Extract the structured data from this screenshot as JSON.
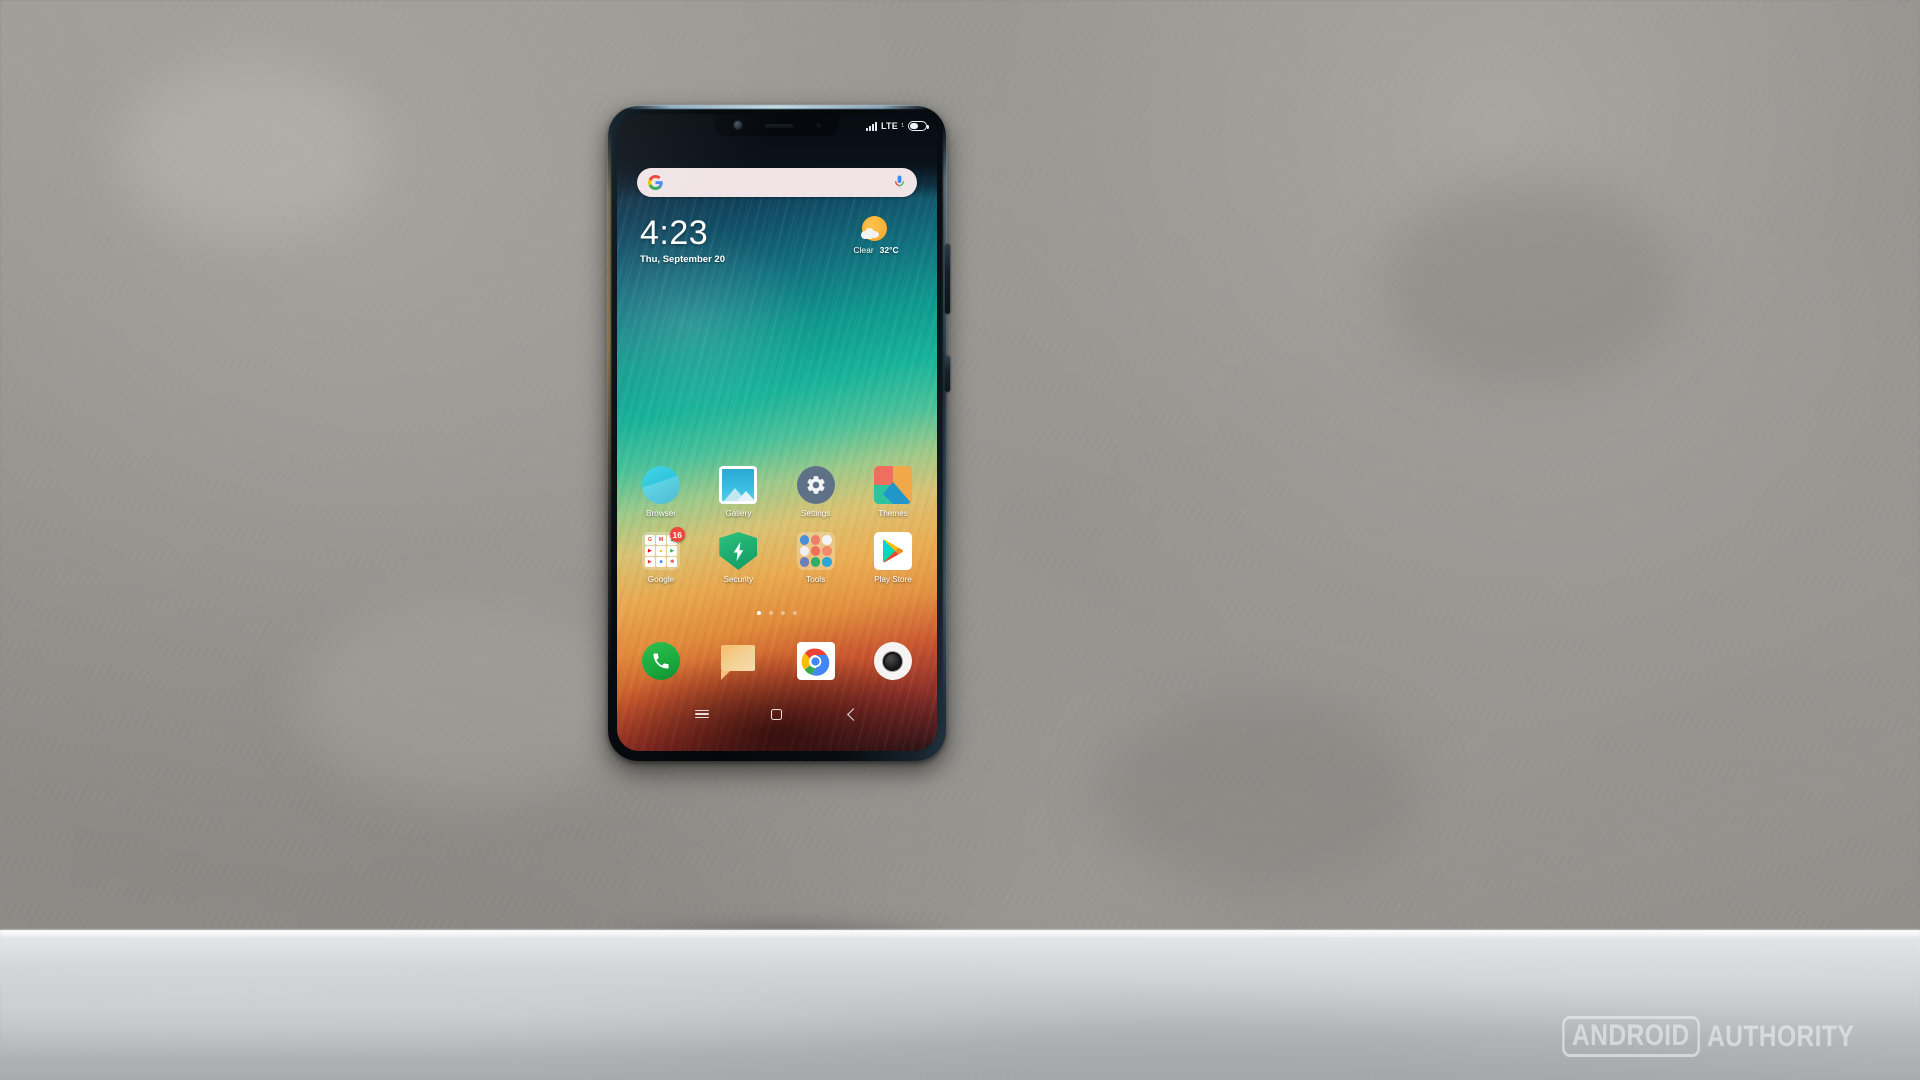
{
  "device": {
    "name": "Xiaomi Redmi smartphone",
    "body_color": "#0a1016"
  },
  "status_bar": {
    "network_label": "LTE",
    "network_sublabel": "1",
    "signal_bars": 4,
    "battery_level_pct": 45
  },
  "search": {
    "placeholder": "",
    "value": "",
    "google_icon": "google-g-icon",
    "mic_icon": "microphone-icon",
    "bar_color": "#f0e4e6"
  },
  "clock_widget": {
    "time": "4:23",
    "date": "Thu, September 20",
    "weather_condition": "Clear",
    "weather_temperature": "32°C",
    "weather_icon": "sun-behind-cloud-icon"
  },
  "home_screen": {
    "rows": [
      [
        {
          "label": "Browser",
          "icon": "browser-icon"
        },
        {
          "label": "Gallery",
          "icon": "gallery-icon"
        },
        {
          "label": "Settings",
          "icon": "settings-gear-icon"
        },
        {
          "label": "Themes",
          "icon": "themes-icon"
        }
      ],
      [
        {
          "label": "Google",
          "icon": "google-folder-icon",
          "badge": "16"
        },
        {
          "label": "Security",
          "icon": "security-shield-icon"
        },
        {
          "label": "Tools",
          "icon": "tools-folder-icon"
        },
        {
          "label": "Play Store",
          "icon": "play-store-icon"
        }
      ]
    ],
    "google_folder_apps": [
      "G",
      "M",
      "✈",
      "▶",
      "▲",
      "▶",
      "▶",
      "■",
      "✿"
    ],
    "page_indicator": {
      "count": 4,
      "active_index": 0
    }
  },
  "dock": [
    {
      "label": "Phone",
      "icon": "phone-handset-icon"
    },
    {
      "label": "Messages",
      "icon": "messages-bubble-icon"
    },
    {
      "label": "Chrome",
      "icon": "chrome-icon"
    },
    {
      "label": "Camera",
      "icon": "camera-lens-icon"
    }
  ],
  "nav_bar": [
    {
      "label": "Recents",
      "icon": "menu-hamburger-icon"
    },
    {
      "label": "Home",
      "icon": "home-square-icon"
    },
    {
      "label": "Back",
      "icon": "chevron-left-icon"
    }
  ],
  "watermark": {
    "boxed_word": "ANDROID",
    "plain_word": "AUTHORITY",
    "color": "#eceef0"
  }
}
